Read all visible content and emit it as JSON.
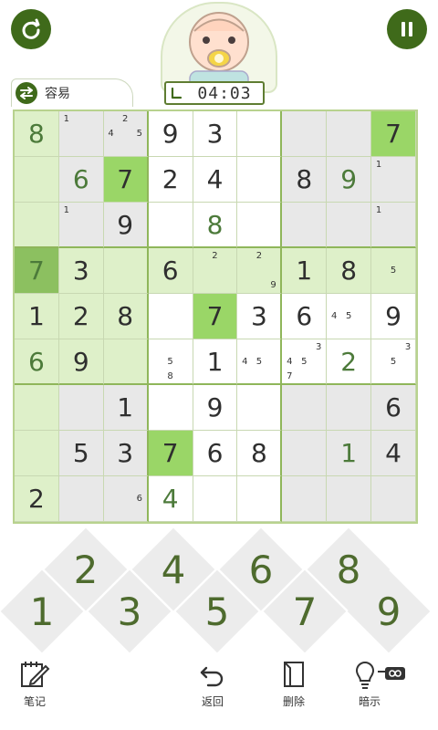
{
  "header": {
    "timer": "04:03",
    "difficulty": "容易"
  },
  "board": {
    "values": [
      [
        "8",
        "",
        "",
        "9",
        "3",
        "",
        "",
        "",
        "7"
      ],
      [
        "",
        "6",
        "7",
        "2",
        "4",
        "",
        "8",
        "9",
        ""
      ],
      [
        "",
        "",
        "9",
        "",
        "8",
        "",
        "",
        "",
        ""
      ],
      [
        "7",
        "3",
        "",
        "6",
        "",
        "",
        "1",
        "8",
        ""
      ],
      [
        "1",
        "2",
        "8",
        "",
        "7",
        "3",
        "6",
        "",
        "9"
      ],
      [
        "6",
        "9",
        "",
        "",
        "1",
        "",
        "",
        "2",
        ""
      ],
      [
        "",
        "",
        "1",
        "",
        "9",
        "",
        "",
        "",
        "6"
      ],
      [
        "",
        "5",
        "3",
        "7",
        "6",
        "8",
        "",
        "1",
        "4"
      ],
      [
        "2",
        "",
        "",
        "4",
        "",
        "",
        "",
        "",
        ""
      ]
    ],
    "notes": {
      "0_1": [
        "1"
      ],
      "0_2": [
        "2",
        "4",
        "5"
      ],
      "1_8": [
        "1"
      ],
      "2_1": [
        "1"
      ],
      "2_8": [
        "1"
      ],
      "3_4": [
        "2"
      ],
      "3_5": [
        "2",
        "9"
      ],
      "3_8": [
        "5"
      ],
      "4_7": [
        "4",
        "5"
      ],
      "5_3": [
        "5",
        "8"
      ],
      "5_5": [
        "4",
        "5"
      ],
      "5_6": [
        "3",
        "4",
        "5",
        "7"
      ],
      "5_8": [
        "3",
        "5"
      ],
      "8_2": [
        "6"
      ]
    },
    "note_positions": {
      "0_1": [
        0
      ],
      "0_2": [
        1,
        3,
        5
      ],
      "1_8": [
        0
      ],
      "2_1": [
        0
      ],
      "2_8": [
        0
      ],
      "3_4": [
        1
      ],
      "3_5": [
        1,
        8
      ],
      "3_8": [
        4
      ],
      "4_7": [
        3,
        4
      ],
      "5_3": [
        4,
        7
      ],
      "5_5": [
        3,
        4
      ],
      "5_6": [
        2,
        3,
        4,
        6
      ],
      "5_8": [
        2,
        4
      ],
      "8_2": [
        5
      ]
    },
    "filled": [
      "0_0",
      "1_1",
      "1_7",
      "2_4",
      "5_0",
      "5_7",
      "7_7",
      "8_3",
      "3_0"
    ]
  },
  "numpad": [
    "1",
    "2",
    "3",
    "4",
    "5",
    "6",
    "7",
    "8",
    "9"
  ],
  "toolbar": {
    "notes_label": "笔记",
    "undo_label": "返回",
    "delete_label": "删除",
    "hint_label": "暗示"
  },
  "colors": {
    "accent": "#3f6a1a",
    "selected_cell": "#9ad667",
    "highlight_cell": "#def0c9",
    "grid_line": "#8fb65a"
  }
}
